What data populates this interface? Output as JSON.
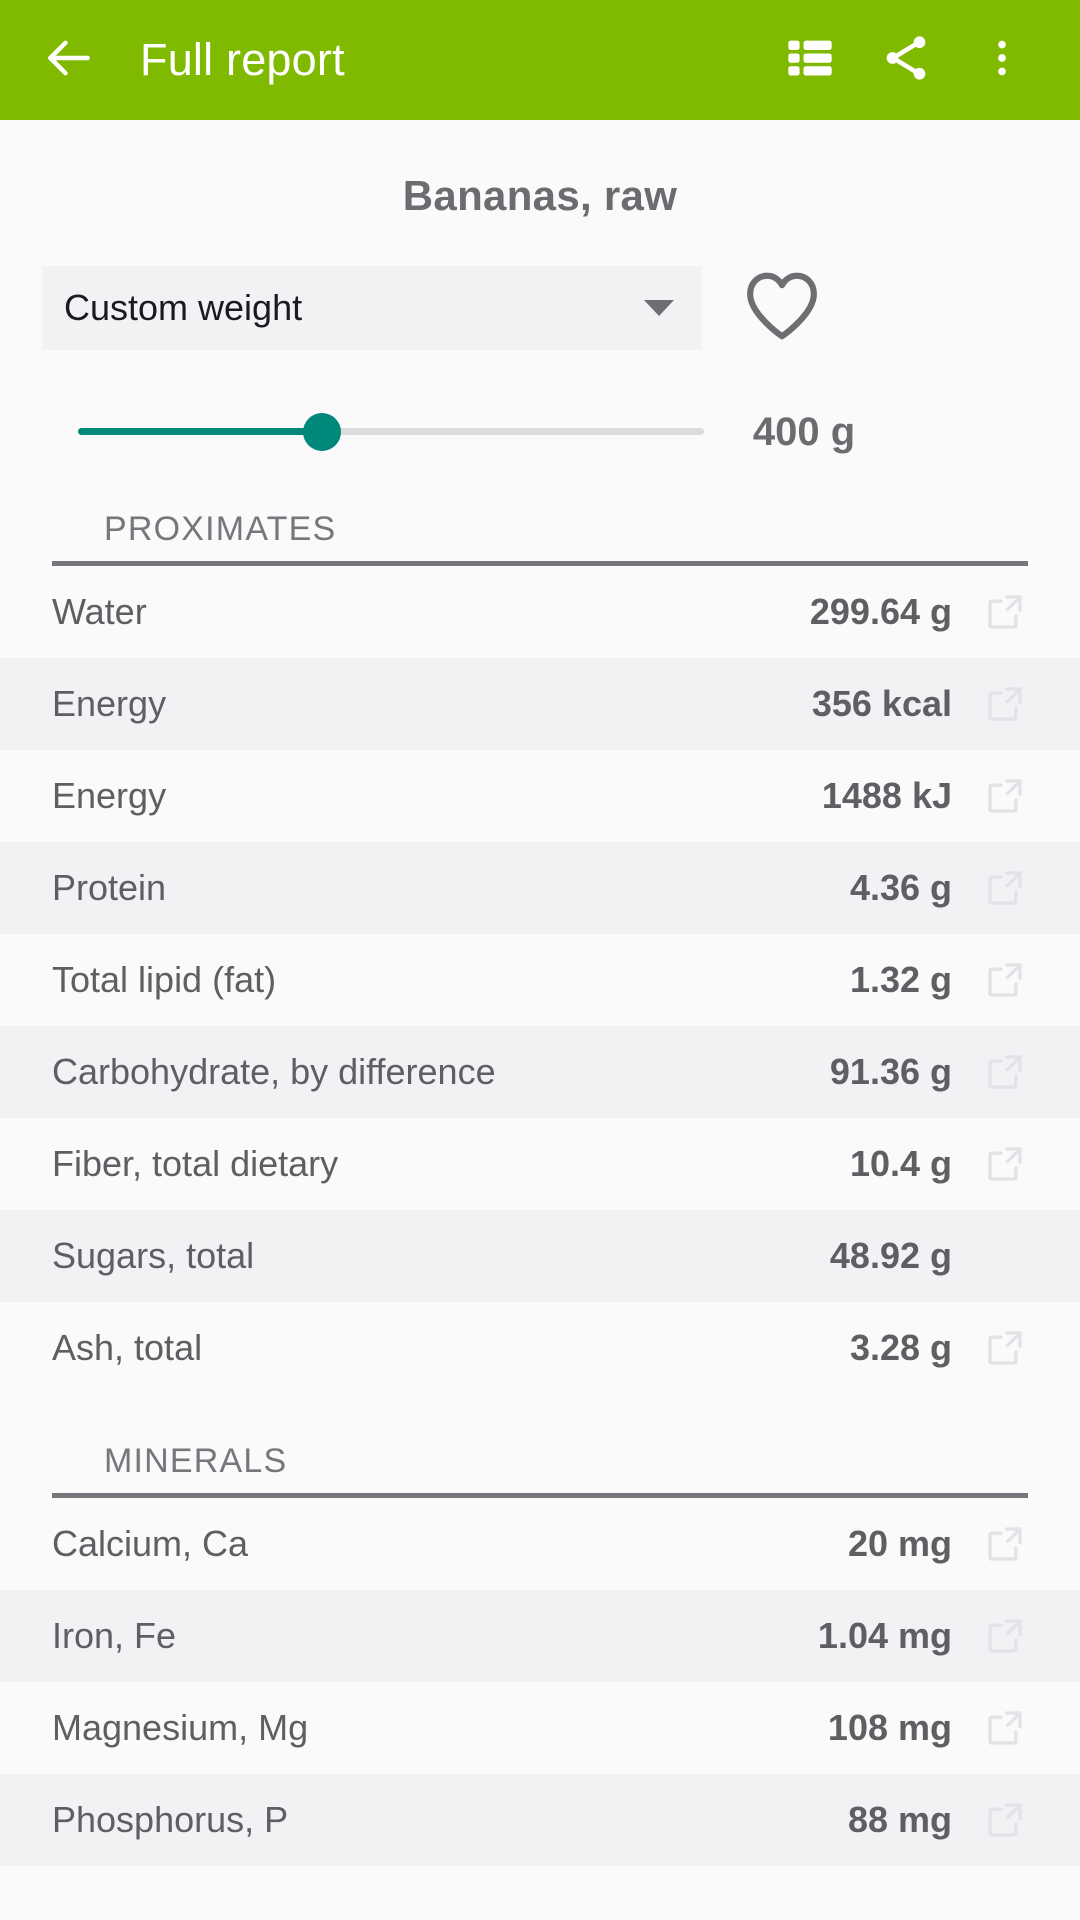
{
  "appbar": {
    "back_icon": "arrow-left-icon",
    "title": "Full report",
    "actions": [
      {
        "name": "list-view-icon",
        "label": "List view"
      },
      {
        "name": "share-icon",
        "label": "Share"
      },
      {
        "name": "overflow-menu-icon",
        "label": "More options"
      }
    ],
    "color": "#80ba00"
  },
  "food": {
    "title": "Bananas, raw"
  },
  "portion": {
    "selected": "Custom weight",
    "caret_icon": "chevron-down-icon",
    "favorite_icon": "heart-outline-icon"
  },
  "slider": {
    "value_label": "400 g",
    "percent": 39,
    "fill_color": "#00897b",
    "track_color": "#dcdcdc"
  },
  "sections": [
    {
      "header": "PROXIMATES",
      "rows": [
        {
          "label": "Water",
          "value": "299.64 g",
          "alt": false,
          "link": true
        },
        {
          "label": "Energy",
          "value": "356 kcal",
          "alt": true,
          "link": true
        },
        {
          "label": "Energy",
          "value": "1488 kJ",
          "alt": false,
          "link": true
        },
        {
          "label": "Protein",
          "value": "4.36 g",
          "alt": true,
          "link": true
        },
        {
          "label": "Total lipid (fat)",
          "value": "1.32 g",
          "alt": false,
          "link": true
        },
        {
          "label": "Carbohydrate, by difference",
          "value": "91.36 g",
          "alt": true,
          "link": true
        },
        {
          "label": "Fiber, total dietary",
          "value": "10.4 g",
          "alt": false,
          "link": true
        },
        {
          "label": "Sugars, total",
          "value": "48.92 g",
          "alt": true,
          "link": false
        },
        {
          "label": "Ash, total",
          "value": "3.28 g",
          "alt": false,
          "link": true
        }
      ]
    },
    {
      "header": "MINERALS",
      "rows": [
        {
          "label": "Calcium, Ca",
          "value": "20 mg",
          "alt": false,
          "link": true
        },
        {
          "label": "Iron, Fe",
          "value": "1.04 mg",
          "alt": true,
          "link": true
        },
        {
          "label": "Magnesium, Mg",
          "value": "108 mg",
          "alt": false,
          "link": true
        },
        {
          "label": "Phosphorus, P",
          "value": "88 mg",
          "alt": true,
          "link": true
        }
      ]
    }
  ],
  "icons": {
    "row_link": "open-in-new-icon"
  }
}
